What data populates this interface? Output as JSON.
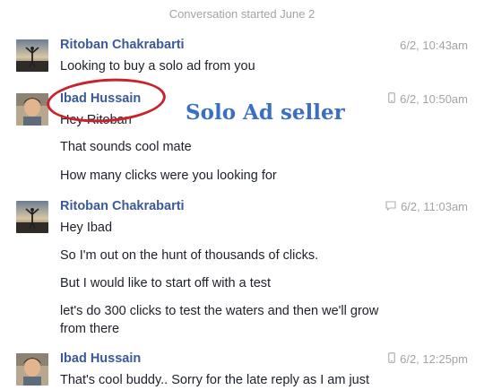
{
  "header": {
    "conversation_started": "Conversation started June 2"
  },
  "messages": [
    {
      "sender": "Ritoban Chakrabarti",
      "time": "6/2, 10:43am",
      "source_icon": "none",
      "lines": [
        "Looking to buy a solo ad from you"
      ]
    },
    {
      "sender": "Ibad Hussain",
      "time": "6/2, 10:50am",
      "source_icon": "mobile-phone-icon",
      "lines": [
        "Hey Ritoban",
        "That sounds cool mate",
        "How many clicks were you looking for"
      ]
    },
    {
      "sender": "Ritoban Chakrabarti",
      "time": "6/2, 11:03am",
      "source_icon": "chat-bubble-icon",
      "lines": [
        "Hey Ibad",
        "So I'm out on the hunt of thousands of clicks.",
        "But I would like to start off with a test",
        "let's do 300 clicks to test the waters and then we'll grow",
        "from there"
      ]
    },
    {
      "sender": "Ibad Hussain",
      "time": "6/2, 12:25pm",
      "source_icon": "mobile-phone-icon",
      "lines": [
        "That's cool buddy.. Sorry for the late reply as I am just"
      ]
    }
  ],
  "annotation": {
    "text": "Solo Ad seller",
    "color": "#3b6fc4",
    "circle_color": "#c8232c"
  },
  "colors": {
    "sender_name": "#3b5998",
    "meta": "#a3a3a3",
    "body_text": "#1d2129"
  }
}
